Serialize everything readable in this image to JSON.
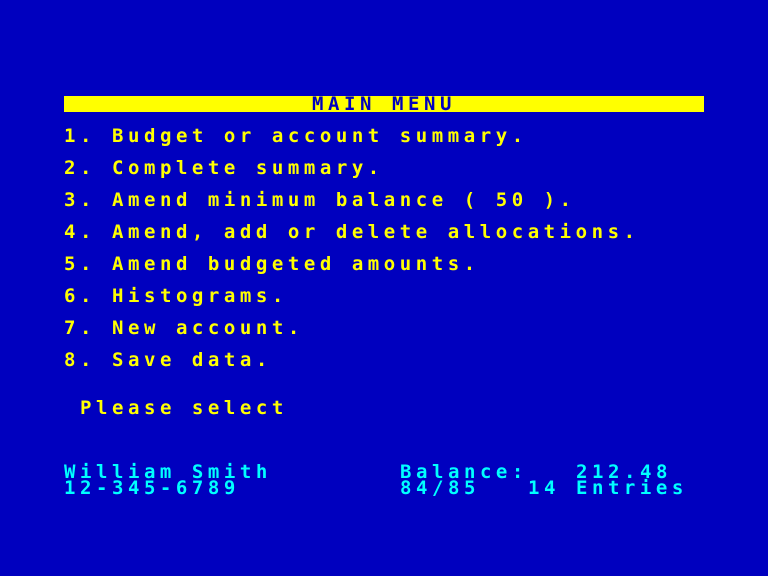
{
  "colors": {
    "background": "#0000BF",
    "primary_text": "#FFFF00",
    "footer_text": "#00FFFF"
  },
  "menu": {
    "title": "MAIN MENU",
    "items": [
      {
        "number": "1.",
        "label": "Budget or account summary."
      },
      {
        "number": "2.",
        "label": "Complete summary."
      },
      {
        "number": "3.",
        "label": "Amend minimum balance ( 50 )."
      },
      {
        "number": "4.",
        "label": "Amend, add or delete allocations."
      },
      {
        "number": "5.",
        "label": "Amend budgeted amounts."
      },
      {
        "number": "6.",
        "label": "Histograms."
      },
      {
        "number": "7.",
        "label": "New account."
      },
      {
        "number": "8.",
        "label": "Save data."
      }
    ],
    "prompt": "Please select"
  },
  "footer": {
    "name": "William Smith",
    "account_number": "12-345-6789",
    "balance_label": "Balance:",
    "balance_value": "212.48",
    "period": "84/85",
    "entries": "14 Entries"
  }
}
